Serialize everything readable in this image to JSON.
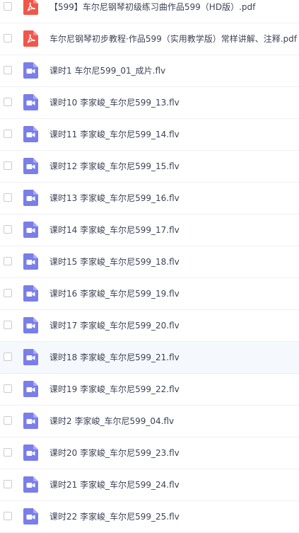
{
  "files": [
    {
      "name": "【599】车尔尼钢琴初级练习曲作品599（HD版）.pdf",
      "icon": "pdf-icon"
    },
    {
      "name": "车尔尼钢琴初步教程·作品599（实用教学版）常样讲解、注释.pdf",
      "icon": "pdf-icon"
    },
    {
      "name": "课时1 车尔尼599_01_成片.flv",
      "icon": "video-icon"
    },
    {
      "name": "课时10 李家峻_车尔尼599_13.flv",
      "icon": "video-icon"
    },
    {
      "name": "课时11 李家峻_车尔尼599_14.flv",
      "icon": "video-icon"
    },
    {
      "name": "课时12 李家峻_车尔尼599_15.flv",
      "icon": "video-icon"
    },
    {
      "name": "课时13 李家峻_车尔尼599_16.flv",
      "icon": "video-icon"
    },
    {
      "name": "课时14 李家峻_车尔尼599_17.flv",
      "icon": "video-icon"
    },
    {
      "name": "课时15 李家峻_车尔尼599_18.flv",
      "icon": "video-icon"
    },
    {
      "name": "课时16 李家峻_车尔尼599_19.flv",
      "icon": "video-icon"
    },
    {
      "name": "课时17 李家峻_车尔尼599_20.flv",
      "icon": "video-icon"
    },
    {
      "name": "课时18 李家峻_车尔尼599_21.flv",
      "icon": "video-icon",
      "hovered": true
    },
    {
      "name": "课时19 李家峻_车尔尼599_22.flv",
      "icon": "video-icon"
    },
    {
      "name": "课时2 李家峻_车尔尼599_04.flv",
      "icon": "video-icon"
    },
    {
      "name": "课时20 李家峻_车尔尼599_23.flv",
      "icon": "video-icon"
    },
    {
      "name": "课时21 李家峻_车尔尼599_24.flv",
      "icon": "video-icon"
    },
    {
      "name": "课时22 李家峻_车尔尼599_25.flv",
      "icon": "video-icon"
    }
  ],
  "colors": {
    "pdf": "#f0574a",
    "video": "#7a7ee8",
    "text": "#3d4357",
    "row_hover": "#f5f8fd"
  }
}
